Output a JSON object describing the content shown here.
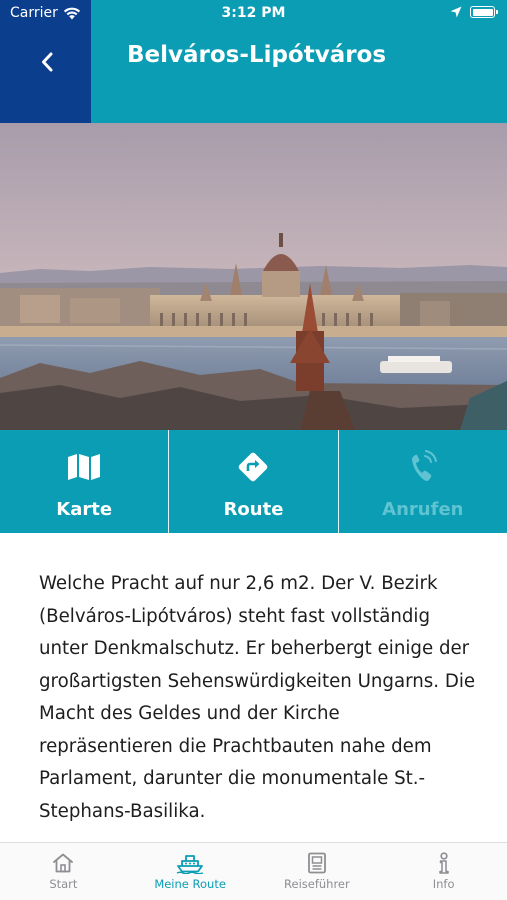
{
  "status_bar": {
    "carrier": "Carrier",
    "time": "3:12 PM"
  },
  "header": {
    "title": "Belváros-Lipótváros",
    "back_icon": "chevron-left-icon"
  },
  "hero_image": {
    "subject": "budapest-parliament-photo"
  },
  "actions": [
    {
      "label": "Karte",
      "icon": "map-icon",
      "enabled": true
    },
    {
      "label": "Route",
      "icon": "directions-icon",
      "enabled": true
    },
    {
      "label": "Anrufen",
      "icon": "phone-icon",
      "enabled": false
    }
  ],
  "description": "Welche Pracht auf nur 2,6 m2. Der V. Bezirk (Belváros-Lipótváros) steht fast vollständig unter Denkmalschutz. Er beherbergt einige der großartigsten Sehenswürdigkeiten Ungarns. Die Macht des Geldes und der Kirche repräsentieren die Prachtbauten nahe dem Parlament, darunter die monumentale St.-Stephans-Basilika.",
  "tabs": [
    {
      "label": "Start",
      "icon": "home-icon",
      "active": false
    },
    {
      "label": "Meine Route",
      "icon": "ship-icon",
      "active": true
    },
    {
      "label": "Reiseführer",
      "icon": "guidebook-icon",
      "active": false
    },
    {
      "label": "Info",
      "icon": "info-icon",
      "active": false
    }
  ],
  "colors": {
    "primary": "#0a9db4",
    "back_box": "#0b3e8c",
    "disabled_label": "#5fc3d2",
    "tab_inactive": "#8e8e93"
  }
}
